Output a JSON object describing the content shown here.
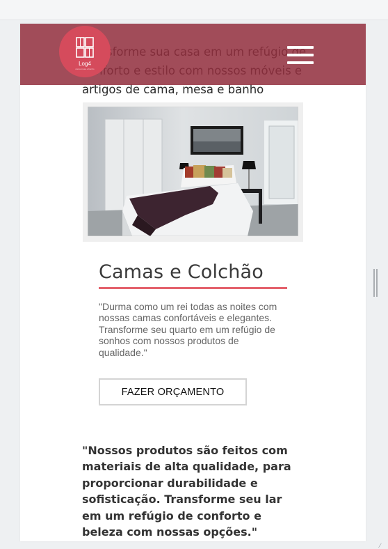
{
  "header": {
    "logo_name": "Log4",
    "logo_tagline": "cama mesa e banho",
    "behind_text": "Transforme sua casa em um refúgio de conforto e estilo com nossos móveis e artigos de cama, mesa e banho",
    "menu_icon": "hamburger-menu-icon",
    "logo_icon": "windows-grid-logo-icon"
  },
  "product": {
    "image_alt": "Quarto moderno com cama de casal",
    "title": "Camas e Colchão",
    "quote": "\"Durma como um rei todas as noites com nossas camas confortáveis e elegantes. Transforme seu quarto em um refúgio de sonhos com nossos produtos de qualidade.\"",
    "cta_label": "FAZER ORÇAMENTO"
  },
  "statement": "\"Nossos produtos são feitos com materiais de alta qualidade, para proporcionar durabilidade e sofisticação. Transforme seu lar em um refúgio de conforto e beleza com nossas opções.\"",
  "colors": {
    "navbar": "#912e3e",
    "logo_circle": "#d54b5c",
    "accent_underline": "#e4616c"
  }
}
